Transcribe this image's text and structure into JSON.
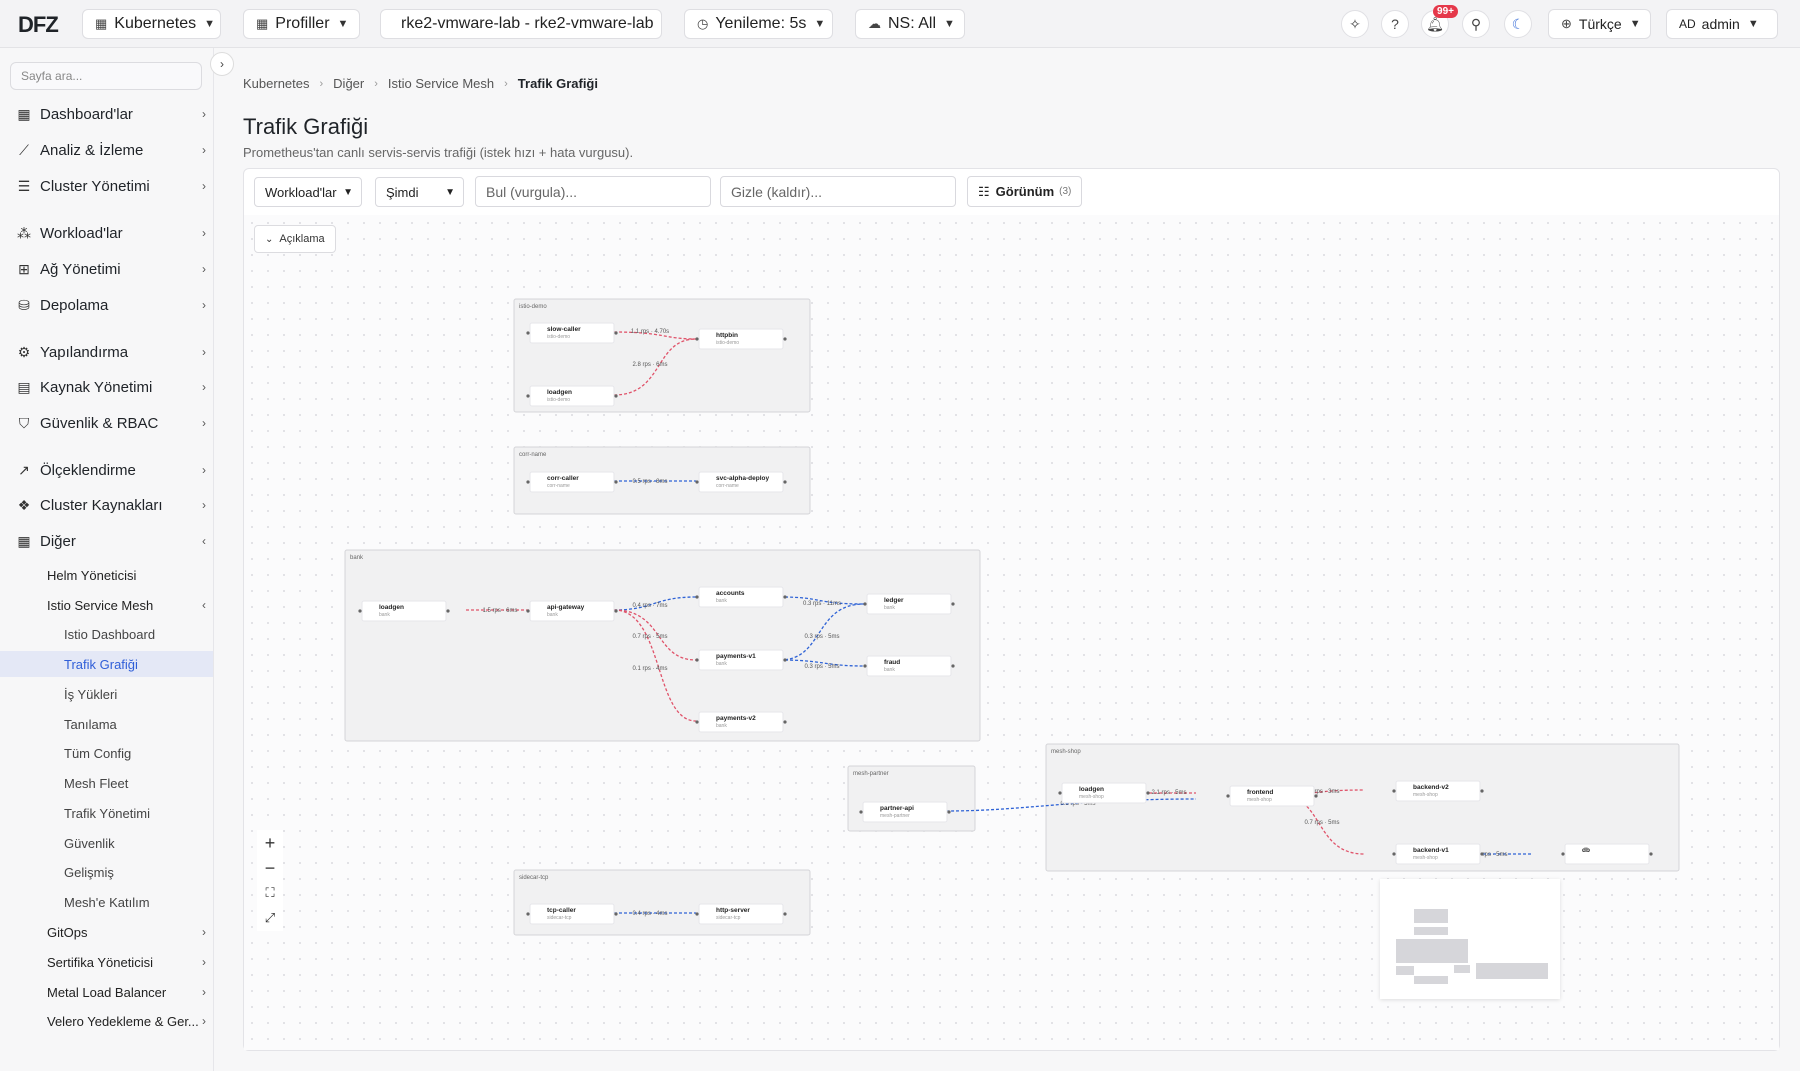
{
  "topbar": {
    "logo": "DFZ",
    "cluster_type": "Kubernetes",
    "profiles": "Profiller",
    "cluster_name": "rke2-vmware-lab - rke2-vmware-lab",
    "refresh": "Yenileme: 5s",
    "namespace": "NS: All",
    "notifications_badge": "99+",
    "language": "Türkçe",
    "user_initials": "AD",
    "user_name": "admin"
  },
  "sidebar": {
    "search_placeholder": "Sayfa ara...",
    "items": [
      {
        "label": "Dashboard'lar",
        "icon": "dashboard-icon"
      },
      {
        "label": "Analiz & İzleme",
        "icon": "chart-line-icon"
      },
      {
        "label": "Cluster Yönetimi",
        "icon": "server-icon"
      },
      {
        "label": "Workload'lar",
        "icon": "cubes-icon"
      },
      {
        "label": "Ağ Yönetimi",
        "icon": "network-icon"
      },
      {
        "label": "Depolama",
        "icon": "database-icon"
      },
      {
        "label": "Yapılandırma",
        "icon": "gear-icon"
      },
      {
        "label": "Kaynak Yönetimi",
        "icon": "resource-icon"
      },
      {
        "label": "Güvenlik & RBAC",
        "icon": "shield-icon"
      },
      {
        "label": "Ölçeklendirme",
        "icon": "trend-icon"
      },
      {
        "label": "Cluster Kaynakları",
        "icon": "nodes-icon"
      },
      {
        "label": "Diğer",
        "icon": "grid-icon"
      }
    ],
    "sub_items": [
      "Helm Yöneticisi",
      "Istio Service Mesh"
    ],
    "istio_items": [
      "Istio Dashboard",
      "Trafik Grafiği",
      "İş Yükleri",
      "Tanılama",
      "Tüm Config",
      "Mesh Fleet",
      "Trafik Yönetimi",
      "Güvenlik",
      "Gelişmiş",
      "Mesh'e Katılım"
    ],
    "other_items": [
      "GitOps",
      "Sertifika Yöneticisi",
      "Metal Load Balancer",
      "Velero Yedekleme & Ger..."
    ]
  },
  "breadcrumb": [
    "Kubernetes",
    "Diğer",
    "Istio Service Mesh",
    "Trafik Grafiği"
  ],
  "page": {
    "title": "Trafik Grafiği",
    "subtitle": "Prometheus'tan canlı servis-servis trafiği (istek hızı + hata vurgusu)."
  },
  "toolbar": {
    "graph_type": "Workload'lar",
    "time": "Şimdi",
    "find_placeholder": "Bul (vurgula)...",
    "hide_placeholder": "Gizle (kaldır)...",
    "view_label": "Görünüm",
    "view_count": "(3)",
    "legend_label": "Açıklama"
  },
  "graph": {
    "colors": {
      "error": "#e0536a",
      "ok": "#2f63d6"
    },
    "groups": [
      {
        "name": "istio-demo"
      },
      {
        "name": "corr-name"
      },
      {
        "name": "bank"
      },
      {
        "name": "mesh-partner"
      },
      {
        "name": "mesh-shop"
      },
      {
        "name": "sidecar-tcp"
      }
    ],
    "nodes": {
      "slow_caller": {
        "name": "slow-caller",
        "ns": "istio-demo"
      },
      "httpbin": {
        "name": "httpbin",
        "ns": "istio-demo"
      },
      "loadgen_demo": {
        "name": "loadgen",
        "ns": "istio-demo"
      },
      "corr_caller": {
        "name": "corr-caller",
        "ns": "corr-name"
      },
      "svc_alpha": {
        "name": "svc-alpha-deploy",
        "ns": "corr-name"
      },
      "loadgen_bank": {
        "name": "loadgen",
        "ns": "bank"
      },
      "api_gateway": {
        "name": "api-gateway",
        "ns": "bank"
      },
      "accounts": {
        "name": "accounts",
        "ns": "bank"
      },
      "ledger": {
        "name": "ledger",
        "ns": "bank"
      },
      "payments_v1": {
        "name": "payments-v1",
        "ns": "bank"
      },
      "fraud": {
        "name": "fraud",
        "ns": "bank"
      },
      "payments_v2": {
        "name": "payments-v2",
        "ns": "bank"
      },
      "partner_api": {
        "name": "partner-api",
        "ns": "mesh-partner"
      },
      "loadgen_shop": {
        "name": "loadgen",
        "ns": "mesh-shop"
      },
      "frontend": {
        "name": "frontend",
        "ns": "mesh-shop"
      },
      "backend_v2": {
        "name": "backend-v2",
        "ns": "mesh-shop"
      },
      "backend_v1": {
        "name": "backend-v1",
        "ns": "mesh-shop"
      },
      "db": {
        "name": "db",
        "ns": ""
      },
      "tcp_caller": {
        "name": "tcp-caller",
        "ns": "sidecar-tcp"
      },
      "http_server": {
        "name": "http-server",
        "ns": "sidecar-tcp"
      }
    },
    "edges": {
      "slow_httpbin": "1.1 rps · 4.70s",
      "loadgen_httpbin": "2.8 rps · 6ms",
      "corr_alpha": "0.5 rps · 8ms",
      "loadgen_api": "1.5 rps · 6ms",
      "api_accounts": "0.4 rps · 7ms",
      "api_payv1": "0.7 rps · 5ms",
      "api_payv2": "0.1 rps · 4ms",
      "accounts_ledger": "0.3 rps · 11ms",
      "payv1_ledger": "0.3 rps · 5ms",
      "payv1_fraud": "0.3 rps · 5ms",
      "shop_loadgen_frontend": "2.1 rps · 5ms",
      "partner_frontend": "0.5 rps · 5ms",
      "frontend_bv2": "0.2 rps · 3ms",
      "frontend_bv1": "0.7 rps · 5ms",
      "bv1_db": "0.5 rps · 5ms",
      "tcp_http": "0.4 rps · 4ms"
    }
  }
}
